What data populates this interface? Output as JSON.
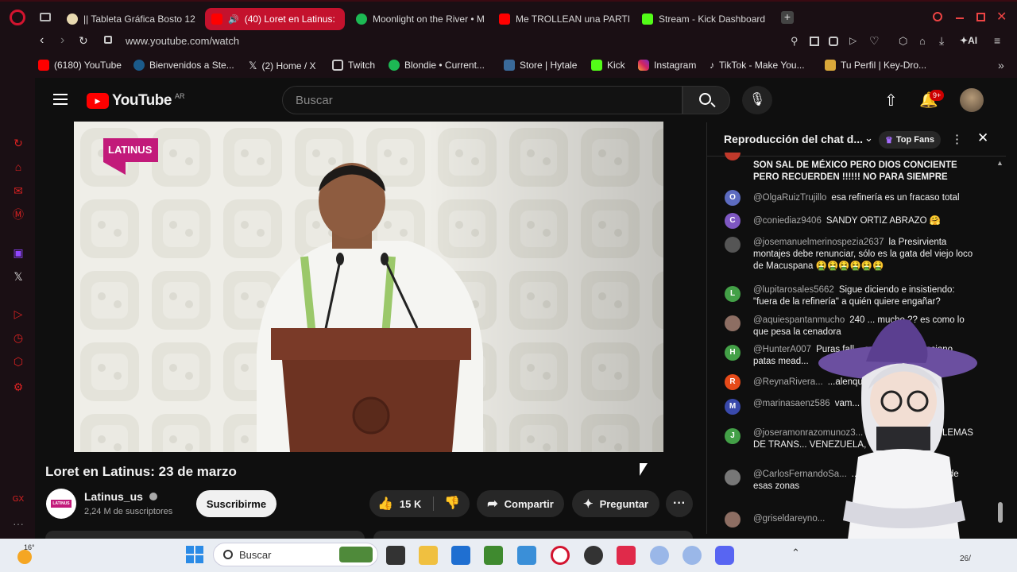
{
  "browser": {
    "tabs": [
      {
        "title": "|| Tableta Gráfica Bosto 12",
        "active": false
      },
      {
        "title": "(40) Loret en Latinus:",
        "active": true
      },
      {
        "title": "Moonlight on the River • M",
        "active": false
      },
      {
        "title": "Me TROLLEAN una PARTI",
        "active": false
      },
      {
        "title": "Stream - Kick Dashboard",
        "active": false
      }
    ],
    "new_tab": "+",
    "url": "www.youtube.com/watch",
    "ai_label": "AI",
    "bookmarks": [
      "(6180) YouTube",
      "Bienvenidos a Ste...",
      "(2) Home / X",
      "Twitch",
      "Blondie • Current...",
      "Store | Hytale",
      "Kick",
      "Instagram",
      "TikTok - Make You...",
      "Tu Perfil | Key-Dro..."
    ]
  },
  "youtube": {
    "logo": "YouTube",
    "region": "AR",
    "search_placeholder": "Buscar",
    "notif_count": "9+",
    "video": {
      "overlay_logo": "LATINUS",
      "title": "Loret en Latinus: 23 de marzo",
      "channel": "Latinus_us",
      "channel_short": "LATINUS",
      "subscribers": "2,24 M de suscriptores",
      "subscribe": "Suscribirme",
      "likes": "15 K",
      "share": "Compartir",
      "ask": "Preguntar"
    },
    "chat": {
      "title": "Reproducción del chat d...",
      "top_fans": "Top Fans",
      "messages": [
        {
          "user": "",
          "text": "SON SAL DE MÉXICO PERO DIOS CONCIENTE PERO RECUERDEN !!!!!! NO PARA SIEMPRE",
          "initial": "",
          "color": "#c0392b"
        },
        {
          "user": "@OlgaRuizTrujillo",
          "text": "esa refinería es un fracaso total",
          "initial": "O",
          "color": "#5c6bc0"
        },
        {
          "user": "@coniediaz9406",
          "text": "SANDY ORTIZ ABRAZO 🤗",
          "initial": "C",
          "color": "#7e57c2"
        },
        {
          "user": "@josemanuelmerinospezia2637",
          "text": "la Presirvienta montajes debe renunciar, sólo es la gata del viejo loco de Macuspana 🤮🤮🤮🤮🤮🤮",
          "initial": "",
          "color": "#555"
        },
        {
          "user": "@lupitarosales5662",
          "text": "Sigue diciendo e insistiendo: \"fuera de la refinería\" a quién quiere engañar?",
          "initial": "L",
          "color": "#43a047"
        },
        {
          "user": "@aquiespantanmucho",
          "text": "240 ... mucho ?? es como lo que pesa la cenadora",
          "initial": "",
          "color": "#8d6e63"
        },
        {
          "user": "@HunterA007",
          "text": "Puras fall... caprichos del anciano patas mead...",
          "initial": "H",
          "color": "#43a047"
        },
        {
          "user": "@ReynaRivera...",
          "text": "...alenque",
          "initial": "R",
          "color": "#e64a19"
        },
        {
          "user": "@marinasaenz586",
          "text": "vam... a este 2027",
          "initial": "M",
          "color": "#3949ab"
        },
        {
          "user": "@joseramonrazomunoz3...",
          "text": "...TAN LOS PROBLEMAS DE TRANS... VENEZUELA, CUBA, N...",
          "initial": "J",
          "color": "#43a047"
        },
        {
          "user": "@CarlosFernandoSa...",
          "text": "...rios estan contamin... de esas zonas",
          "initial": "",
          "color": "#777"
        },
        {
          "user": "@griseldareyno...",
          "text": "",
          "initial": "",
          "color": "#8d6e63"
        }
      ]
    }
  },
  "taskbar": {
    "weather": "16°",
    "search": "Buscar",
    "clock": "26/"
  },
  "colors": {
    "opera_red": "#c4122d",
    "yt_red": "#ff0000",
    "chrome_bg": "#1a0f14"
  }
}
